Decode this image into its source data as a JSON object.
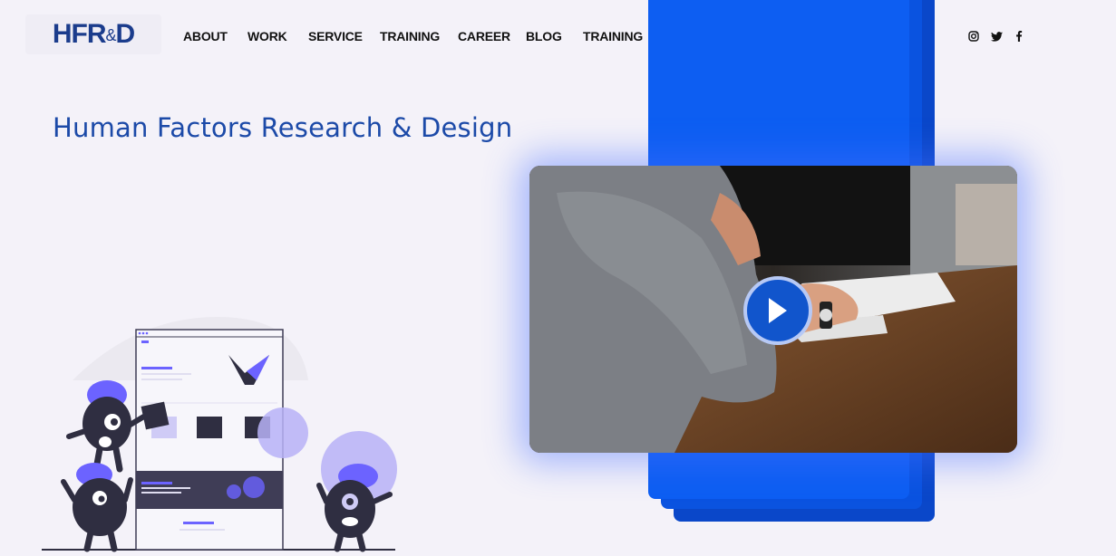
{
  "brand": {
    "logo_main": "HFR",
    "logo_amp": "&",
    "logo_end": "D"
  },
  "nav": {
    "items": [
      {
        "id": "about",
        "label": "ABOUT"
      },
      {
        "id": "work",
        "label": "WORK"
      },
      {
        "id": "service",
        "label": "SERVICE"
      },
      {
        "id": "training-1",
        "label": "TRAINING"
      },
      {
        "id": "career",
        "label": "CAREER"
      },
      {
        "id": "blog",
        "label": "BLOG"
      },
      {
        "id": "training-2",
        "label": "TRAINING"
      }
    ]
  },
  "social": [
    "instagram-icon",
    "twitter-icon",
    "facebook-icon"
  ],
  "hero": {
    "title": "Human Factors Research & Design"
  },
  "colors": {
    "accent": "#0d5ef2",
    "brand": "#1b3c8c",
    "title": "#1c4aa8",
    "illustration": "#6c63ff"
  }
}
